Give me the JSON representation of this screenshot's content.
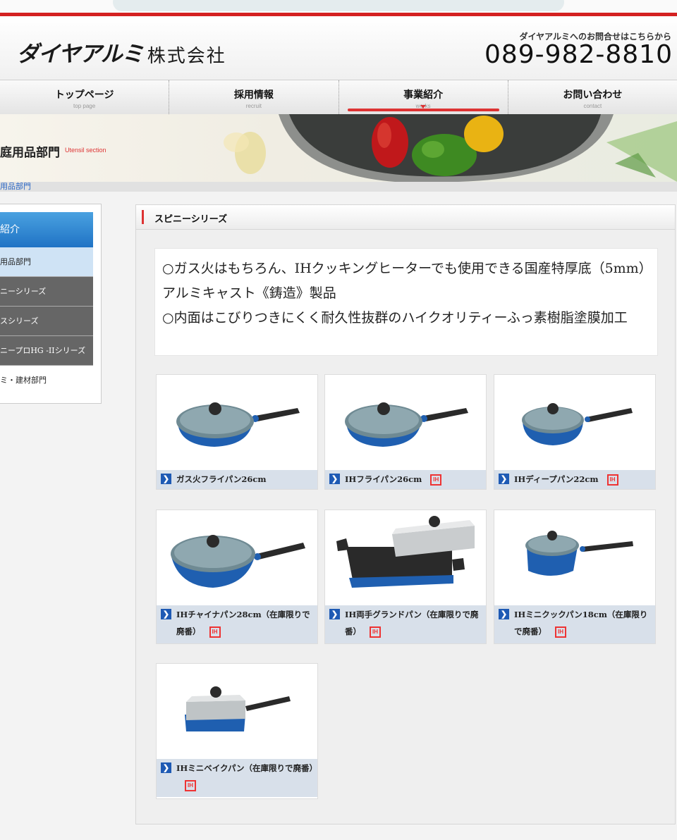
{
  "header": {
    "logo_mark": "ダイヤアルミ",
    "logo_company": "株式会社",
    "contact_label": "ダイヤアルミへのお問合せはこちらから",
    "phone": "089-982-8810"
  },
  "nav": [
    {
      "label": "トップページ",
      "sub": "top page",
      "active": false
    },
    {
      "label": "採用情報",
      "sub": "recruit",
      "active": false
    },
    {
      "label": "事業紹介",
      "sub": "works",
      "active": true
    },
    {
      "label": "お問い合わせ",
      "sub": "contact",
      "active": false
    }
  ],
  "banner": {
    "title": "庭用品部門",
    "subtitle": "Utensil section",
    "breadcrumb": "用品部門"
  },
  "sidebar": {
    "heading": "紹介",
    "items": [
      {
        "label": "用品部門"
      },
      {
        "label": "ニーシリーズ"
      },
      {
        "label": "スシリーズ"
      },
      {
        "label": "ニープロHG -IIシリーズ"
      },
      {
        "label": "ミ・建材部門"
      }
    ]
  },
  "content": {
    "section_title": "スピニーシリーズ",
    "description": [
      "○ガス火はもちろん、IHクッキングヒーターでも使用できる国産特厚底（5mm）アルミキャスト《鋳造》製品",
      "○内面はこびりつきにくく耐久性抜群のハイクオリティーふっ素樹脂塗膜加工"
    ]
  },
  "products": [
    {
      "name": "ガス火フライパン26cm",
      "ih": false
    },
    {
      "name": "IHフライパン26cm",
      "ih": true
    },
    {
      "name": "IHディープパン22cm",
      "ih": true
    },
    {
      "name": "IHチャイナパン28cm（在庫限りで廃番）",
      "ih": true
    },
    {
      "name": "IH両手グランドパン（在庫限りで廃番）",
      "ih": true
    },
    {
      "name": "IHミニクックパン18cm（在庫限りで廃番）",
      "ih": true
    },
    {
      "name": "IHミニベイクパン（在庫限りで廃番）",
      "ih": true
    }
  ],
  "ih_badge": "IH",
  "colors": {
    "accent_red": "#d42121",
    "link_blue": "#1e5ab4",
    "pan_blue": "#1f5fb0"
  }
}
